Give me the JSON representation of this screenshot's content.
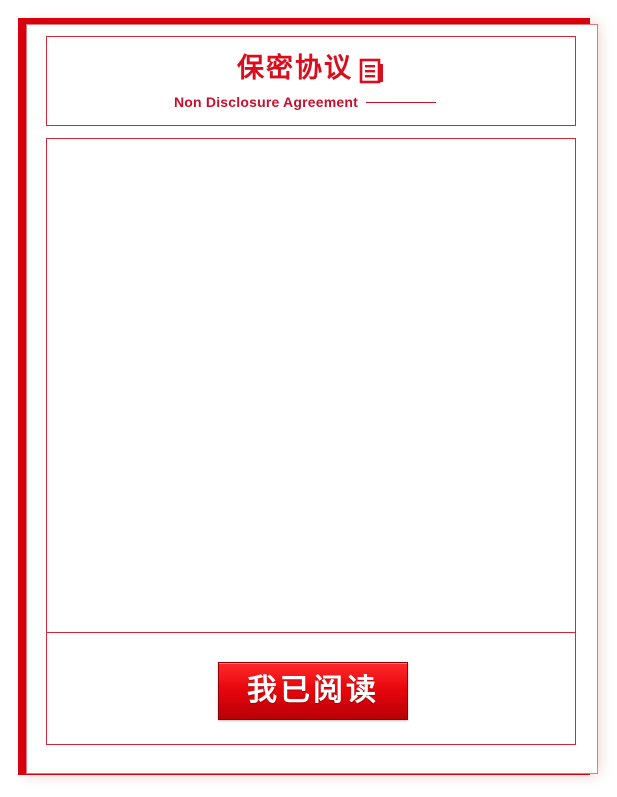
{
  "header": {
    "title": "保密协议",
    "subtitle": "Non Disclosure Agreement",
    "title_icon": "document-icon"
  },
  "content": {
    "body_text": ""
  },
  "actions": {
    "read_button_label": "我已阅读"
  },
  "colors": {
    "brand_red": "#d90d1d",
    "border_red": "#d4263a",
    "backdrop_red": "#d9000f",
    "button_text": "#ffffff"
  }
}
